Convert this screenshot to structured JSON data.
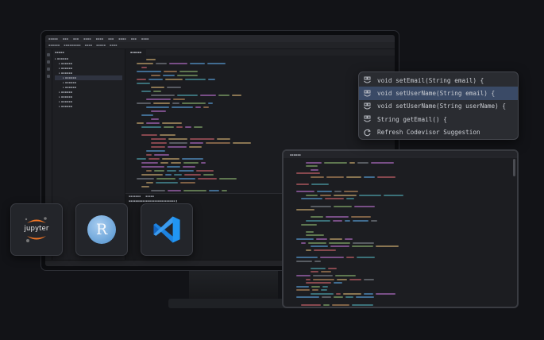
{
  "suggestion_popup": {
    "items": [
      {
        "label": "void setEmail(String email) {",
        "icon": "suggestion-icon",
        "active": false
      },
      {
        "label": "void setUserName(String email) {",
        "icon": "suggestion-icon",
        "active": true
      },
      {
        "label": "void setUserName(String userName) {",
        "icon": "suggestion-icon",
        "active": false
      },
      {
        "label": "String getEmail() {",
        "icon": "suggestion-icon",
        "active": false
      },
      {
        "label": "Refresh Codevisor Suggestion",
        "icon": "refresh-icon",
        "active": false
      }
    ]
  },
  "apps": {
    "jupyter": {
      "label": "jupyter",
      "icon": "jupyter-logo-icon",
      "colors": [
        "#f37726",
        "#767677"
      ]
    },
    "r": {
      "label": "R",
      "icon": "r-logo-icon",
      "color": "#6aa3d8"
    },
    "vscode": {
      "icon": "vscode-logo-icon",
      "color": "#1e88e5"
    }
  },
  "colors": {
    "accent": "#3a4a66",
    "popup_bg": "#2a2c31",
    "background": "#121317"
  }
}
